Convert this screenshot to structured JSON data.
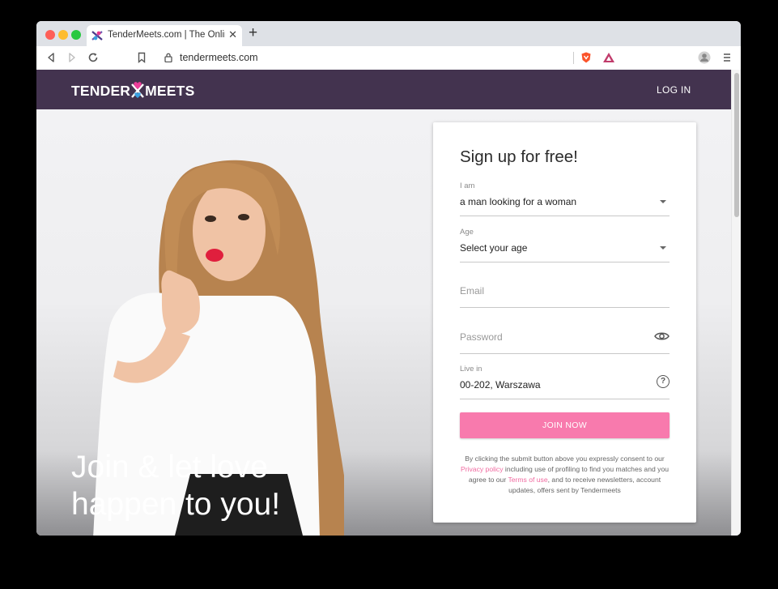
{
  "browser": {
    "tab_title": "TenderMeets.com | The Online D",
    "url": "tendermeets.com",
    "icons": [
      "back-icon",
      "forward-icon",
      "reload-icon",
      "bookmark-icon",
      "lock-icon",
      "brave-shield-icon",
      "brave-rewards-icon",
      "profile-icon",
      "menu-icon"
    ]
  },
  "site": {
    "logo_left": "TENDER",
    "logo_right": "MEETS",
    "login_label": "LOG IN",
    "brand_color": "#43334f",
    "accent_color": "#f87aad"
  },
  "hero": {
    "headline_line1": "Join & let love",
    "headline_line2": "happen to you!"
  },
  "signup": {
    "title": "Sign up for free!",
    "iam_label": "I am",
    "iam_value": "a man looking for a woman",
    "age_label": "Age",
    "age_value": "Select your age",
    "email_placeholder": "Email",
    "password_placeholder": "Password",
    "live_label": "Live in",
    "live_value": "00-202, Warszawa",
    "help_glyph": "?",
    "join_label": "JOIN NOW",
    "consent_part1": "By clicking the submit button above you expressly consent to our ",
    "privacy_link": "Privacy policy",
    "consent_part2": " including use of profiling to find you matches and you agree to our ",
    "terms_link": "Terms of use",
    "consent_part3": ", and to receive newsletters, account updates, offers sent by Tendermeets"
  }
}
